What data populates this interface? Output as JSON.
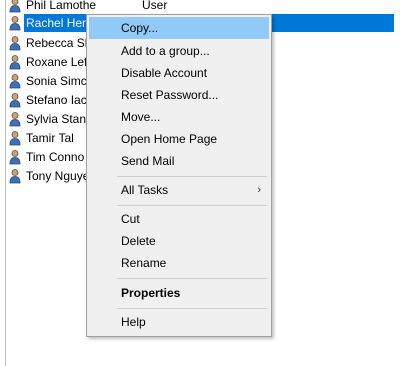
{
  "list": {
    "rows": [
      {
        "name": "Phil Lamothe",
        "type": "User"
      },
      {
        "name": "Rachel Hern"
      },
      {
        "name": "Rebecca Sh"
      },
      {
        "name": "Roxane Lefe"
      },
      {
        "name": "Sonia Simcl"
      },
      {
        "name": "Stefano Iace"
      },
      {
        "name": "Sylvia Stani"
      },
      {
        "name": "Tamir Tal"
      },
      {
        "name": "Tim Conno"
      },
      {
        "name": "Tony Nguye"
      }
    ]
  },
  "menu": {
    "copy": "Copy...",
    "add_to_group": "Add to a group...",
    "disable_account": "Disable Account",
    "reset_password": "Reset Password...",
    "move": "Move...",
    "open_home_page": "Open Home Page",
    "send_mail": "Send Mail",
    "all_tasks": "All Tasks",
    "cut": "Cut",
    "delete": "Delete",
    "rename": "Rename",
    "properties": "Properties",
    "help": "Help"
  },
  "colors": {
    "selection": "#0078d7",
    "menu_highlight": "#91c9f7"
  },
  "icons": {
    "row_icon": "user-icon",
    "submenu_arrow": "chevron-right-icon"
  }
}
